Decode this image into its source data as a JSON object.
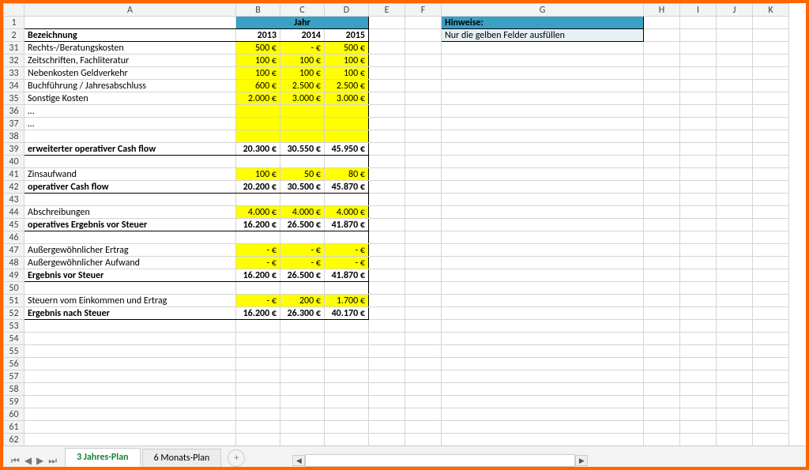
{
  "columns": [
    "",
    "A",
    "B",
    "C",
    "D",
    "E",
    "F",
    "G",
    "H",
    "I",
    "J",
    "K"
  ],
  "header": {
    "jahr_label": "Jahr",
    "bezeichnung": "Bezeichnung",
    "years": [
      "2013",
      "2014",
      "2015"
    ],
    "hinweise_label": "Hinweise:",
    "hinweise_text": "Nur die gelben Felder ausfüllen"
  },
  "rows": [
    {
      "num": "31",
      "label": "Rechts-/Beratungskosten",
      "vals": [
        "500 €",
        "-   €",
        "500 €"
      ],
      "yellow": true
    },
    {
      "num": "32",
      "label": "Zeitschriften, Fachliteratur",
      "vals": [
        "100 €",
        "100 €",
        "100 €"
      ],
      "yellow": true
    },
    {
      "num": "33",
      "label": "Nebenkosten Geldverkehr",
      "vals": [
        "100 €",
        "100 €",
        "100 €"
      ],
      "yellow": true
    },
    {
      "num": "34",
      "label": "Buchführung / Jahresabschluss",
      "vals": [
        "600 €",
        "2.500 €",
        "2.500 €"
      ],
      "yellow": true
    },
    {
      "num": "35",
      "label": "Sonstige Kosten",
      "vals": [
        "2.000 €",
        "3.000 €",
        "3.000 €"
      ],
      "yellow": true
    },
    {
      "num": "36",
      "label": "…",
      "vals": [
        "",
        "",
        ""
      ],
      "yellow": true
    },
    {
      "num": "37",
      "label": "…",
      "vals": [
        "",
        "",
        ""
      ],
      "yellow": true
    },
    {
      "num": "38",
      "label": "",
      "vals": [
        "",
        "",
        ""
      ],
      "yellow": true
    },
    {
      "num": "39",
      "label": "erweiterter operativer Cash flow",
      "vals": [
        "20.300 €",
        "30.550 €",
        "45.950 €"
      ],
      "bold": true,
      "sum": true
    },
    {
      "num": "40",
      "label": "",
      "vals": [
        "",
        "",
        ""
      ]
    },
    {
      "num": "41",
      "label": "Zinsaufwand",
      "vals": [
        "100 €",
        "50 €",
        "80 €"
      ],
      "yellow": true
    },
    {
      "num": "42",
      "label": "operativer Cash flow",
      "vals": [
        "20.200 €",
        "30.500 €",
        "45.870 €"
      ],
      "bold": true,
      "sum": true
    },
    {
      "num": "43",
      "label": "",
      "vals": [
        "",
        "",
        ""
      ]
    },
    {
      "num": "44",
      "label": "Abschreibungen",
      "vals": [
        "4.000 €",
        "4.000 €",
        "4.000 €"
      ],
      "yellow": true
    },
    {
      "num": "45",
      "label": "operatives Ergebnis vor Steuer",
      "vals": [
        "16.200 €",
        "26.500 €",
        "41.870 €"
      ],
      "bold": true,
      "sum": true
    },
    {
      "num": "46",
      "label": "",
      "vals": [
        "",
        "",
        ""
      ]
    },
    {
      "num": "47",
      "label": "Außergewöhnlicher Ertrag",
      "vals": [
        "-   €",
        "-   €",
        "-   €"
      ],
      "yellow": true
    },
    {
      "num": "48",
      "label": "Außergewöhnlicher Aufwand",
      "vals": [
        "-   €",
        "-   €",
        "-   €"
      ],
      "yellow": true
    },
    {
      "num": "49",
      "label": "Ergebnis vor Steuer",
      "vals": [
        "16.200 €",
        "26.500 €",
        "41.870 €"
      ],
      "bold": true,
      "sum": true
    },
    {
      "num": "50",
      "label": "",
      "vals": [
        "",
        "",
        ""
      ]
    },
    {
      "num": "51",
      "label": "Steuern vom Einkommen und Ertrag",
      "vals": [
        "-   €",
        "200 €",
        "1.700 €"
      ],
      "yellow": true
    },
    {
      "num": "52",
      "label": "Ergebnis nach Steuer",
      "vals": [
        "16.200 €",
        "26.300 €",
        "40.170 €"
      ],
      "bold": true,
      "sum": true
    }
  ],
  "empty_rows": [
    "53",
    "54",
    "55",
    "56",
    "57",
    "58",
    "59",
    "60",
    "61",
    "62"
  ],
  "tabs": {
    "active": "3 Jahres-Plan",
    "other": "6 Monats-Plan"
  },
  "chart_data": {
    "type": "table",
    "title": "3 Jahres-Plan",
    "columns": [
      "Bezeichnung",
      "2013",
      "2014",
      "2015"
    ],
    "rows": [
      [
        "Rechts-/Beratungskosten",
        500,
        0,
        500
      ],
      [
        "Zeitschriften, Fachliteratur",
        100,
        100,
        100
      ],
      [
        "Nebenkosten Geldverkehr",
        100,
        100,
        100
      ],
      [
        "Buchführung / Jahresabschluss",
        600,
        2500,
        2500
      ],
      [
        "Sonstige Kosten",
        2000,
        3000,
        3000
      ],
      [
        "erweiterter operativer Cash flow",
        20300,
        30550,
        45950
      ],
      [
        "Zinsaufwand",
        100,
        50,
        80
      ],
      [
        "operativer Cash flow",
        20200,
        30500,
        45870
      ],
      [
        "Abschreibungen",
        4000,
        4000,
        4000
      ],
      [
        "operatives Ergebnis vor Steuer",
        16200,
        26500,
        41870
      ],
      [
        "Außergewöhnlicher Ertrag",
        0,
        0,
        0
      ],
      [
        "Außergewöhnlicher Aufwand",
        0,
        0,
        0
      ],
      [
        "Ergebnis vor Steuer",
        16200,
        26500,
        41870
      ],
      [
        "Steuern vom Einkommen und Ertrag",
        0,
        200,
        1700
      ],
      [
        "Ergebnis nach Steuer",
        16200,
        26300,
        40170
      ]
    ]
  }
}
